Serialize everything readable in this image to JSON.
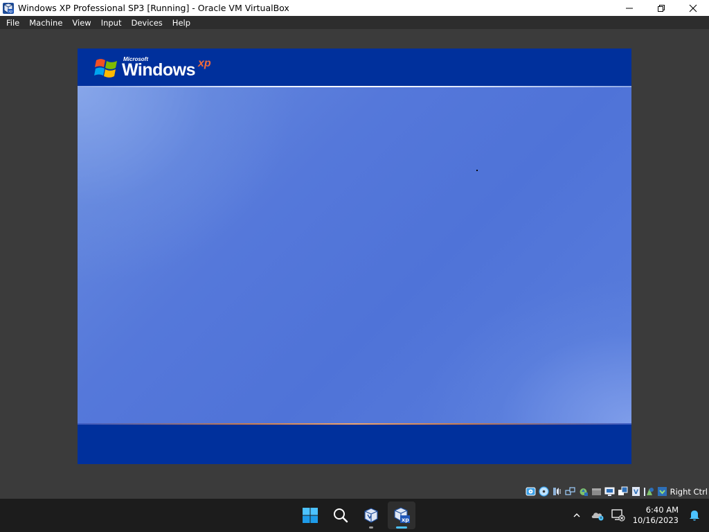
{
  "window": {
    "title": "Windows XP Professional SP3 [Running] - Oracle VM VirtualBox",
    "app_icon": "virtualbox-xp-icon",
    "controls": [
      "minimize-icon",
      "maximize-icon",
      "close-icon"
    ]
  },
  "menu": {
    "items": [
      {
        "label": "File"
      },
      {
        "label": "Machine"
      },
      {
        "label": "View"
      },
      {
        "label": "Input"
      },
      {
        "label": "Devices"
      },
      {
        "label": "Help"
      }
    ]
  },
  "guest": {
    "logo_microsoft": "Microsoft",
    "logo_windows": "Windows",
    "logo_xp": "xp",
    "colors": {
      "band": "#00309c",
      "background": "#5a7edc",
      "xp_accent": "#f26b3a"
    }
  },
  "statusbar": {
    "icons": [
      "hard-disk-icon",
      "optical-drive-icon",
      "audio-icon",
      "network-icon",
      "usb-icon",
      "shared-folders-icon",
      "display-icon",
      "recording-icon",
      "cpu-icon",
      "mouse-integration-icon",
      "keyboard-icon"
    ],
    "host_key": "Right Ctrl"
  },
  "taskbar": {
    "apps": [
      "start-icon",
      "search-icon",
      "virtualbox-manager-icon",
      "virtualbox-xp-vm-icon"
    ],
    "tray_icons": [
      "chevron-up-icon",
      "onedrive-icon",
      "network-disconnected-icon",
      "notifications-bell-icon"
    ],
    "time": "6:40 AM",
    "date": "10/16/2023",
    "accent": "#4cc2ff"
  }
}
